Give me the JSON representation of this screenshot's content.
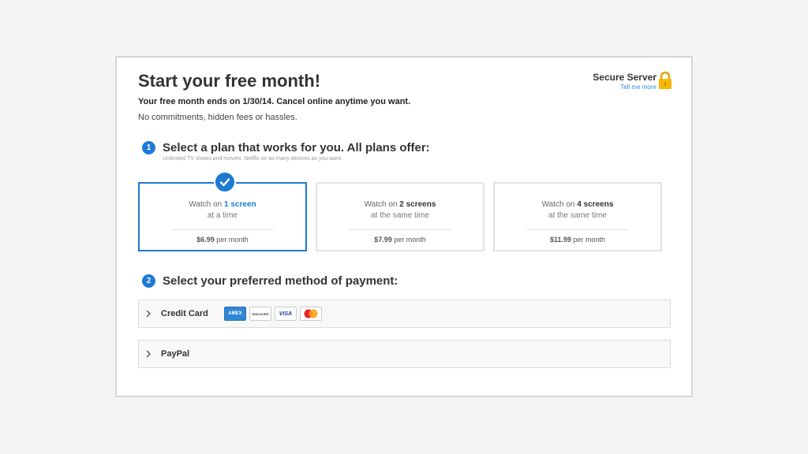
{
  "header": {
    "title": "Start your free month!",
    "subtitle": "Your free month ends on 1/30/14. Cancel online anytime you want.",
    "note": "No commitments, hidden fees or hassles.",
    "secure_label": "Secure Server",
    "secure_link": "Tell me more"
  },
  "step1": {
    "number": "1",
    "title": "Select a plan that works for you. All plans offer:",
    "note": "Unlimited TV shows and movies. Netflix on as many devices as you want."
  },
  "plans": [
    {
      "prefix": "Watch on ",
      "screens": "1 screen",
      "line2": "at a time",
      "price": "$6.99",
      "period": " per month",
      "selected": true
    },
    {
      "prefix": "Watch on ",
      "screens": "2 screens",
      "line2": "at the same time",
      "price": "$7.99",
      "period": " per month",
      "selected": false
    },
    {
      "prefix": "Watch on ",
      "screens": "4 screens",
      "line2": "at the same time",
      "price": "$11.99",
      "period": " per month",
      "selected": false
    }
  ],
  "step2": {
    "number": "2",
    "title": "Select your preferred method of payment:"
  },
  "payment": {
    "credit_card_label": "Credit Card",
    "cards": {
      "amex": "AMEX",
      "discover": "DISCOVER",
      "visa": "VISA",
      "mastercard": "MasterCard"
    },
    "paypal_label": "PayPal"
  },
  "colors": {
    "accent": "#1d7ad0",
    "lock": "#f5b800",
    "link": "#2d8ae0"
  }
}
